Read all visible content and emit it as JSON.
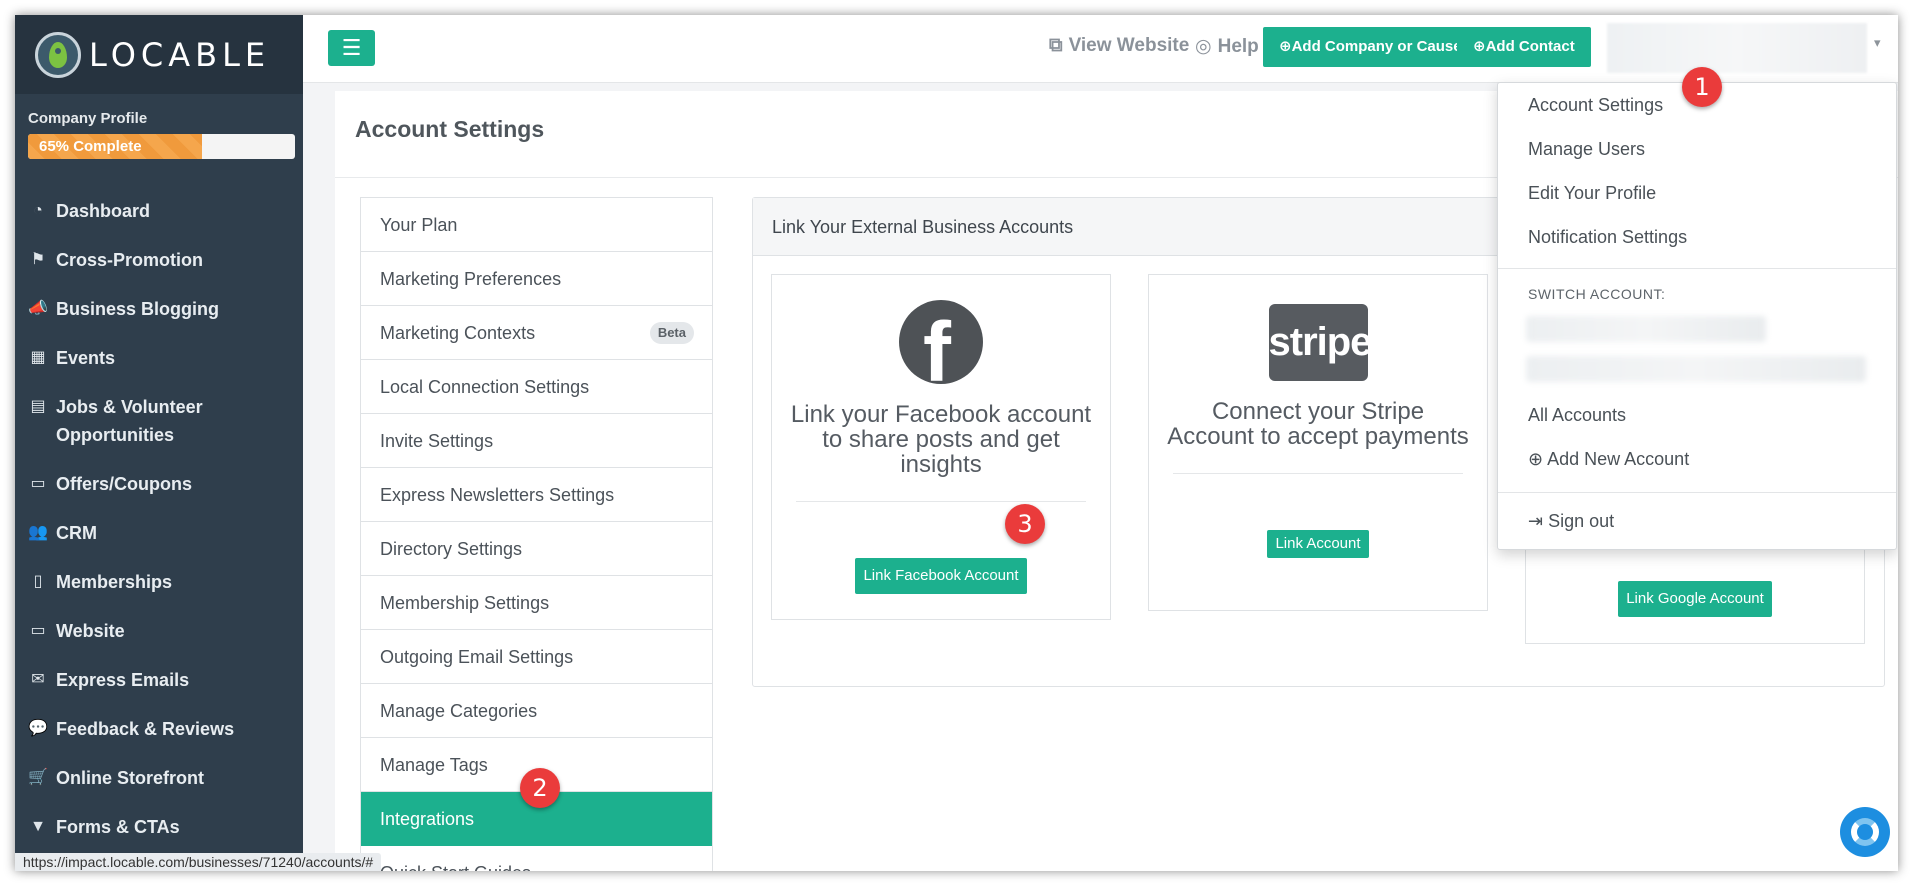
{
  "app": {
    "brand": "LOCABLE",
    "status_url": "https://impact.locable.com/businesses/71240/accounts/#"
  },
  "sidebar": {
    "profile_label": "Company Profile",
    "progress_text": "65% Complete",
    "progress_fraction": 0.65,
    "items": [
      {
        "label": "Dashboard",
        "icon": "gauge-icon"
      },
      {
        "label": "Cross-Promotion",
        "icon": "signpost-icon"
      },
      {
        "label": "Business Blogging",
        "icon": "megaphone-icon"
      },
      {
        "label": "Events",
        "icon": "calendar-icon"
      },
      {
        "label": "Jobs & Volunteer Opportunities",
        "icon": "briefcase-icon"
      },
      {
        "label": "Offers/Coupons",
        "icon": "ticket-icon"
      },
      {
        "label": "CRM",
        "icon": "users-icon"
      },
      {
        "label": "Memberships",
        "icon": "id-badge-icon"
      },
      {
        "label": "Website",
        "icon": "desktop-icon"
      },
      {
        "label": "Express Emails",
        "icon": "envelope-icon"
      },
      {
        "label": "Feedback & Reviews",
        "icon": "comments-icon"
      },
      {
        "label": "Online Storefront",
        "icon": "cart-icon"
      },
      {
        "label": "Forms & CTAs",
        "icon": "filter-icon"
      }
    ]
  },
  "topbar": {
    "view_website": "View Website",
    "help": "Help",
    "add_company": "Add Company or Cause",
    "add_contact": "Add Contact"
  },
  "page": {
    "title": "Account Settings",
    "settings_items": [
      "Your Plan",
      "Marketing Preferences",
      "Marketing Contexts",
      "Local Connection Settings",
      "Invite Settings",
      "Express Newsletters Settings",
      "Directory Settings",
      "Membership Settings",
      "Outgoing Email Settings",
      "Manage Categories",
      "Manage Tags",
      "Integrations",
      "Quick Start Guides"
    ],
    "beta_badge": "Beta",
    "active_item": "Integrations",
    "panel_title": "Link Your External Business Accounts",
    "cards": {
      "facebook": {
        "text": "Link your Facebook account to share posts and get insights",
        "button": "Link Facebook Account"
      },
      "stripe": {
        "logo": "stripe",
        "text": "Connect your Stripe Account to accept payments",
        "button": "Link Account"
      },
      "google": {
        "button": "Link Google Account"
      }
    }
  },
  "dropdown": {
    "account_settings": "Account Settings",
    "manage_users": "Manage Users",
    "edit_profile": "Edit Your Profile",
    "notification_settings": "Notification Settings",
    "switch_account": "SWITCH ACCOUNT:",
    "all_accounts": "All Accounts",
    "add_new_account": "Add New Account",
    "sign_out": "Sign out"
  },
  "steps": [
    "1",
    "2",
    "3"
  ],
  "colors": {
    "accent": "#1cb08e",
    "sidebar": "#2f3e4c",
    "step": "#ea3b3b",
    "progress": "#f5a64c"
  }
}
